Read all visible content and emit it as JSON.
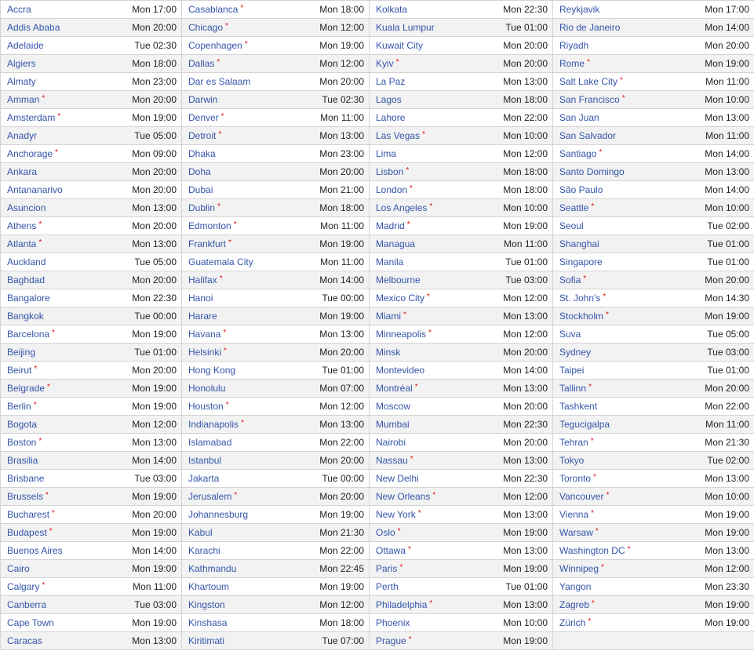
{
  "legend": {
    "dst_marker": "*"
  },
  "colors": {
    "link": "#3355aa",
    "dst_marker": "#dd1111",
    "row_alt": "#f2f2f2"
  },
  "columns": [
    [
      {
        "city": "Accra",
        "time": "Mon 17:00",
        "dst": false
      },
      {
        "city": "Addis Ababa",
        "time": "Mon 20:00",
        "dst": false
      },
      {
        "city": "Adelaide",
        "time": "Tue 02:30",
        "dst": false
      },
      {
        "city": "Algiers",
        "time": "Mon 18:00",
        "dst": false
      },
      {
        "city": "Almaty",
        "time": "Mon 23:00",
        "dst": false
      },
      {
        "city": "Amman",
        "time": "Mon 20:00",
        "dst": true
      },
      {
        "city": "Amsterdam",
        "time": "Mon 19:00",
        "dst": true
      },
      {
        "city": "Anadyr",
        "time": "Tue 05:00",
        "dst": false
      },
      {
        "city": "Anchorage",
        "time": "Mon 09:00",
        "dst": true
      },
      {
        "city": "Ankara",
        "time": "Mon 20:00",
        "dst": false
      },
      {
        "city": "Antananarivo",
        "time": "Mon 20:00",
        "dst": false
      },
      {
        "city": "Asuncion",
        "time": "Mon 13:00",
        "dst": false
      },
      {
        "city": "Athens",
        "time": "Mon 20:00",
        "dst": true
      },
      {
        "city": "Atlanta",
        "time": "Mon 13:00",
        "dst": true
      },
      {
        "city": "Auckland",
        "time": "Tue 05:00",
        "dst": false
      },
      {
        "city": "Baghdad",
        "time": "Mon 20:00",
        "dst": false
      },
      {
        "city": "Bangalore",
        "time": "Mon 22:30",
        "dst": false
      },
      {
        "city": "Bangkok",
        "time": "Tue 00:00",
        "dst": false
      },
      {
        "city": "Barcelona",
        "time": "Mon 19:00",
        "dst": true
      },
      {
        "city": "Beijing",
        "time": "Tue 01:00",
        "dst": false
      },
      {
        "city": "Beirut",
        "time": "Mon 20:00",
        "dst": true
      },
      {
        "city": "Belgrade",
        "time": "Mon 19:00",
        "dst": true
      },
      {
        "city": "Berlin",
        "time": "Mon 19:00",
        "dst": true
      },
      {
        "city": "Bogota",
        "time": "Mon 12:00",
        "dst": false
      },
      {
        "city": "Boston",
        "time": "Mon 13:00",
        "dst": true
      },
      {
        "city": "Brasilia",
        "time": "Mon 14:00",
        "dst": false
      },
      {
        "city": "Brisbane",
        "time": "Tue 03:00",
        "dst": false
      },
      {
        "city": "Brussels",
        "time": "Mon 19:00",
        "dst": true
      },
      {
        "city": "Bucharest",
        "time": "Mon 20:00",
        "dst": true
      },
      {
        "city": "Budapest",
        "time": "Mon 19:00",
        "dst": true
      },
      {
        "city": "Buenos Aires",
        "time": "Mon 14:00",
        "dst": false
      },
      {
        "city": "Cairo",
        "time": "Mon 19:00",
        "dst": false
      },
      {
        "city": "Calgary",
        "time": "Mon 11:00",
        "dst": true
      },
      {
        "city": "Canberra",
        "time": "Tue 03:00",
        "dst": false
      },
      {
        "city": "Cape Town",
        "time": "Mon 19:00",
        "dst": false
      },
      {
        "city": "Caracas",
        "time": "Mon 13:00",
        "dst": false
      }
    ],
    [
      {
        "city": "Casablanca",
        "time": "Mon 18:00",
        "dst": true
      },
      {
        "city": "Chicago",
        "time": "Mon 12:00",
        "dst": true
      },
      {
        "city": "Copenhagen",
        "time": "Mon 19:00",
        "dst": true
      },
      {
        "city": "Dallas",
        "time": "Mon 12:00",
        "dst": true
      },
      {
        "city": "Dar es Salaam",
        "time": "Mon 20:00",
        "dst": false
      },
      {
        "city": "Darwin",
        "time": "Tue 02:30",
        "dst": false
      },
      {
        "city": "Denver",
        "time": "Mon 11:00",
        "dst": true
      },
      {
        "city": "Detroit",
        "time": "Mon 13:00",
        "dst": true
      },
      {
        "city": "Dhaka",
        "time": "Mon 23:00",
        "dst": false
      },
      {
        "city": "Doha",
        "time": "Mon 20:00",
        "dst": false
      },
      {
        "city": "Dubai",
        "time": "Mon 21:00",
        "dst": false
      },
      {
        "city": "Dublin",
        "time": "Mon 18:00",
        "dst": true
      },
      {
        "city": "Edmonton",
        "time": "Mon 11:00",
        "dst": true
      },
      {
        "city": "Frankfurt",
        "time": "Mon 19:00",
        "dst": true
      },
      {
        "city": "Guatemala City",
        "time": "Mon 11:00",
        "dst": false
      },
      {
        "city": "Halifax",
        "time": "Mon 14:00",
        "dst": true
      },
      {
        "city": "Hanoi",
        "time": "Tue 00:00",
        "dst": false
      },
      {
        "city": "Harare",
        "time": "Mon 19:00",
        "dst": false
      },
      {
        "city": "Havana",
        "time": "Mon 13:00",
        "dst": true
      },
      {
        "city": "Helsinki",
        "time": "Mon 20:00",
        "dst": true
      },
      {
        "city": "Hong Kong",
        "time": "Tue 01:00",
        "dst": false
      },
      {
        "city": "Honolulu",
        "time": "Mon 07:00",
        "dst": false
      },
      {
        "city": "Houston",
        "time": "Mon 12:00",
        "dst": true
      },
      {
        "city": "Indianapolis",
        "time": "Mon 13:00",
        "dst": true
      },
      {
        "city": "Islamabad",
        "time": "Mon 22:00",
        "dst": false
      },
      {
        "city": "Istanbul",
        "time": "Mon 20:00",
        "dst": false
      },
      {
        "city": "Jakarta",
        "time": "Tue 00:00",
        "dst": false
      },
      {
        "city": "Jerusalem",
        "time": "Mon 20:00",
        "dst": true
      },
      {
        "city": "Johannesburg",
        "time": "Mon 19:00",
        "dst": false
      },
      {
        "city": "Kabul",
        "time": "Mon 21:30",
        "dst": false
      },
      {
        "city": "Karachi",
        "time": "Mon 22:00",
        "dst": false
      },
      {
        "city": "Kathmandu",
        "time": "Mon 22:45",
        "dst": false
      },
      {
        "city": "Khartoum",
        "time": "Mon 19:00",
        "dst": false
      },
      {
        "city": "Kingston",
        "time": "Mon 12:00",
        "dst": false
      },
      {
        "city": "Kinshasa",
        "time": "Mon 18:00",
        "dst": false
      },
      {
        "city": "Kiritimati",
        "time": "Tue 07:00",
        "dst": false
      }
    ],
    [
      {
        "city": "Kolkata",
        "time": "Mon 22:30",
        "dst": false
      },
      {
        "city": "Kuala Lumpur",
        "time": "Tue 01:00",
        "dst": false
      },
      {
        "city": "Kuwait City",
        "time": "Mon 20:00",
        "dst": false
      },
      {
        "city": "Kyiv",
        "time": "Mon 20:00",
        "dst": true
      },
      {
        "city": "La Paz",
        "time": "Mon 13:00",
        "dst": false
      },
      {
        "city": "Lagos",
        "time": "Mon 18:00",
        "dst": false
      },
      {
        "city": "Lahore",
        "time": "Mon 22:00",
        "dst": false
      },
      {
        "city": "Las Vegas",
        "time": "Mon 10:00",
        "dst": true
      },
      {
        "city": "Lima",
        "time": "Mon 12:00",
        "dst": false
      },
      {
        "city": "Lisbon",
        "time": "Mon 18:00",
        "dst": true
      },
      {
        "city": "London",
        "time": "Mon 18:00",
        "dst": true
      },
      {
        "city": "Los Angeles",
        "time": "Mon 10:00",
        "dst": true
      },
      {
        "city": "Madrid",
        "time": "Mon 19:00",
        "dst": true
      },
      {
        "city": "Managua",
        "time": "Mon 11:00",
        "dst": false
      },
      {
        "city": "Manila",
        "time": "Tue 01:00",
        "dst": false
      },
      {
        "city": "Melbourne",
        "time": "Tue 03:00",
        "dst": false
      },
      {
        "city": "Mexico City",
        "time": "Mon 12:00",
        "dst": true
      },
      {
        "city": "Miami",
        "time": "Mon 13:00",
        "dst": true
      },
      {
        "city": "Minneapolis",
        "time": "Mon 12:00",
        "dst": true
      },
      {
        "city": "Minsk",
        "time": "Mon 20:00",
        "dst": false
      },
      {
        "city": "Montevideo",
        "time": "Mon 14:00",
        "dst": false
      },
      {
        "city": "Montréal",
        "time": "Mon 13:00",
        "dst": true
      },
      {
        "city": "Moscow",
        "time": "Mon 20:00",
        "dst": false
      },
      {
        "city": "Mumbai",
        "time": "Mon 22:30",
        "dst": false
      },
      {
        "city": "Nairobi",
        "time": "Mon 20:00",
        "dst": false
      },
      {
        "city": "Nassau",
        "time": "Mon 13:00",
        "dst": true
      },
      {
        "city": "New Delhi",
        "time": "Mon 22:30",
        "dst": false
      },
      {
        "city": "New Orleans",
        "time": "Mon 12:00",
        "dst": true
      },
      {
        "city": "New York",
        "time": "Mon 13:00",
        "dst": true
      },
      {
        "city": "Oslo",
        "time": "Mon 19:00",
        "dst": true
      },
      {
        "city": "Ottawa",
        "time": "Mon 13:00",
        "dst": true
      },
      {
        "city": "Paris",
        "time": "Mon 19:00",
        "dst": true
      },
      {
        "city": "Perth",
        "time": "Tue 01:00",
        "dst": false
      },
      {
        "city": "Philadelphia",
        "time": "Mon 13:00",
        "dst": true
      },
      {
        "city": "Phoenix",
        "time": "Mon 10:00",
        "dst": false
      },
      {
        "city": "Prague",
        "time": "Mon 19:00",
        "dst": true
      }
    ],
    [
      {
        "city": "Reykjavik",
        "time": "Mon 17:00",
        "dst": false
      },
      {
        "city": "Rio de Janeiro",
        "time": "Mon 14:00",
        "dst": false
      },
      {
        "city": "Riyadh",
        "time": "Mon 20:00",
        "dst": false
      },
      {
        "city": "Rome",
        "time": "Mon 19:00",
        "dst": true
      },
      {
        "city": "Salt Lake City",
        "time": "Mon 11:00",
        "dst": true
      },
      {
        "city": "San Francisco",
        "time": "Mon 10:00",
        "dst": true
      },
      {
        "city": "San Juan",
        "time": "Mon 13:00",
        "dst": false
      },
      {
        "city": "San Salvador",
        "time": "Mon 11:00",
        "dst": false
      },
      {
        "city": "Santiago",
        "time": "Mon 14:00",
        "dst": true
      },
      {
        "city": "Santo Domingo",
        "time": "Mon 13:00",
        "dst": false
      },
      {
        "city": "São Paulo",
        "time": "Mon 14:00",
        "dst": false
      },
      {
        "city": "Seattle",
        "time": "Mon 10:00",
        "dst": true
      },
      {
        "city": "Seoul",
        "time": "Tue 02:00",
        "dst": false
      },
      {
        "city": "Shanghai",
        "time": "Tue 01:00",
        "dst": false
      },
      {
        "city": "Singapore",
        "time": "Tue 01:00",
        "dst": false
      },
      {
        "city": "Sofia",
        "time": "Mon 20:00",
        "dst": true
      },
      {
        "city": "St. John's",
        "time": "Mon 14:30",
        "dst": true
      },
      {
        "city": "Stockholm",
        "time": "Mon 19:00",
        "dst": true
      },
      {
        "city": "Suva",
        "time": "Tue 05:00",
        "dst": false
      },
      {
        "city": "Sydney",
        "time": "Tue 03:00",
        "dst": false
      },
      {
        "city": "Taipei",
        "time": "Tue 01:00",
        "dst": false
      },
      {
        "city": "Tallinn",
        "time": "Mon 20:00",
        "dst": true
      },
      {
        "city": "Tashkent",
        "time": "Mon 22:00",
        "dst": false
      },
      {
        "city": "Tegucigalpa",
        "time": "Mon 11:00",
        "dst": false
      },
      {
        "city": "Tehran",
        "time": "Mon 21:30",
        "dst": true
      },
      {
        "city": "Tokyo",
        "time": "Tue 02:00",
        "dst": false
      },
      {
        "city": "Toronto",
        "time": "Mon 13:00",
        "dst": true
      },
      {
        "city": "Vancouver",
        "time": "Mon 10:00",
        "dst": true
      },
      {
        "city": "Vienna",
        "time": "Mon 19:00",
        "dst": true
      },
      {
        "city": "Warsaw",
        "time": "Mon 19:00",
        "dst": true
      },
      {
        "city": "Washington DC",
        "time": "Mon 13:00",
        "dst": true
      },
      {
        "city": "Winnipeg",
        "time": "Mon 12:00",
        "dst": true
      },
      {
        "city": "Yangon",
        "time": "Mon 23:30",
        "dst": false
      },
      {
        "city": "Zagreb",
        "time": "Mon 19:00",
        "dst": true
      },
      {
        "city": "Zürich",
        "time": "Mon 19:00",
        "dst": true
      }
    ]
  ]
}
